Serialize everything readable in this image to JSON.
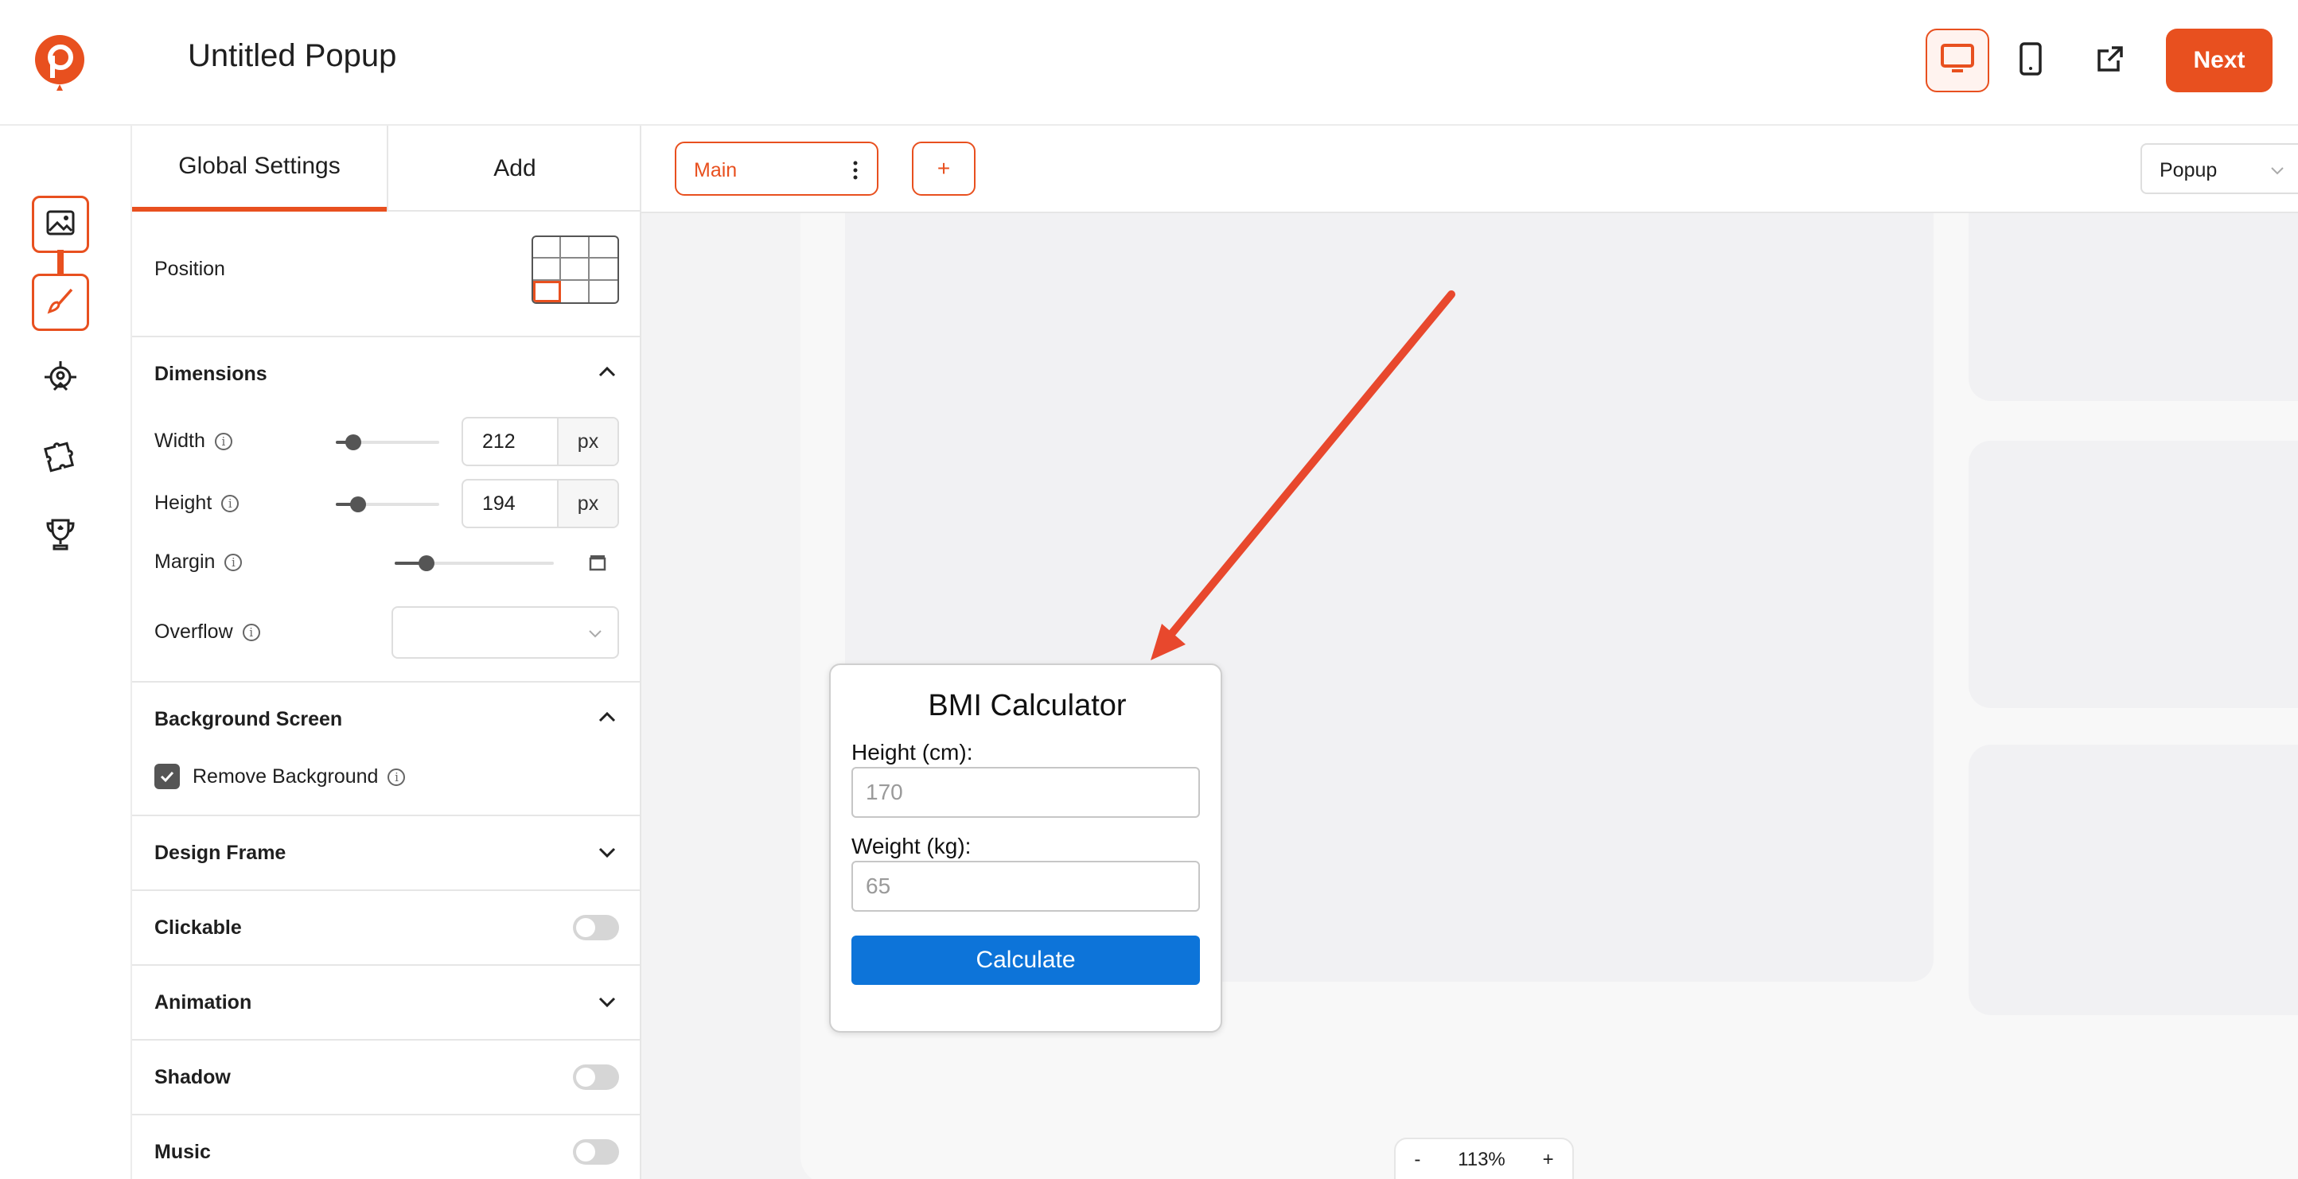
{
  "header": {
    "title": "Untitled Popup",
    "next_label": "Next",
    "icons": {
      "logo": "poptin-balloon-logo",
      "desktop": "desktop-icon",
      "mobile": "mobile-icon",
      "external": "external-link-icon"
    }
  },
  "rail": {
    "items": [
      {
        "icon": "image-icon",
        "active": true
      },
      {
        "icon": "brush-icon",
        "active": true
      },
      {
        "icon": "target-icon",
        "active": false
      },
      {
        "icon": "puzzle-icon",
        "active": false
      },
      {
        "icon": "trophy-icon",
        "active": false
      }
    ]
  },
  "panel": {
    "tabs": [
      "Global Settings",
      "Add"
    ],
    "position_label": "Position",
    "dimensions": {
      "title": "Dimensions",
      "width_label": "Width",
      "width_value": "212",
      "height_label": "Height",
      "height_value": "194",
      "unit": "px",
      "margin_label": "Margin",
      "overflow_label": "Overflow",
      "overflow_value": ""
    },
    "background_screen": {
      "title": "Background Screen",
      "remove_background_label": "Remove Background",
      "remove_background_checked": true
    },
    "sections": {
      "design_frame": "Design Frame",
      "clickable": "Clickable",
      "animation": "Animation",
      "shadow": "Shadow",
      "music": "Music"
    },
    "toggles": {
      "clickable": false,
      "shadow": false,
      "music": false
    }
  },
  "canvas": {
    "page_tab_label": "Main",
    "add_page_label": "+",
    "type_select_value": "Popup",
    "zoom": {
      "minus": "-",
      "value": "113%",
      "plus": "+"
    }
  },
  "bmi": {
    "title": "BMI Calculator",
    "height_label": "Height (cm):",
    "height_placeholder": "170",
    "weight_label": "Weight (kg):",
    "weight_placeholder": "65",
    "button_label": "Calculate"
  },
  "colors": {
    "accent": "#e8501f",
    "calculate_button": "#0d74d9",
    "annotation_arrow": "#e8482d"
  }
}
